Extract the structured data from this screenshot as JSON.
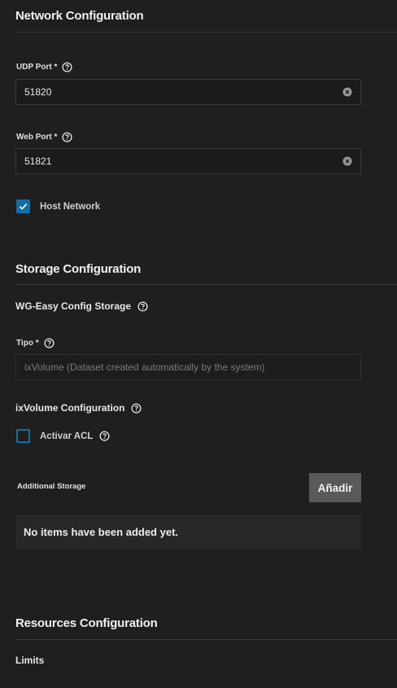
{
  "network": {
    "title": "Network Configuration",
    "udp_port": {
      "label": "UDP Port *",
      "value": "51820"
    },
    "web_port": {
      "label": "Web Port *",
      "value": "51821"
    },
    "host_network": {
      "label": "Host Network",
      "checked": true
    }
  },
  "storage": {
    "title": "Storage Configuration",
    "config_storage_label": "WG-Easy Config Storage",
    "tipo": {
      "label": "Tipo *",
      "value": "ixVolume (Dataset created automatically by the system)"
    },
    "ixvolume_label": "ixVolume Configuration",
    "acl": {
      "label": "Activar ACL",
      "checked": false
    },
    "additional_label": "Additional Storage",
    "add_button": "Añadir",
    "empty_message": "No items have been added yet."
  },
  "resources": {
    "title": "Resources Configuration",
    "limits_label": "Limits"
  },
  "colors": {
    "background": "#1f1f1f",
    "accent": "#0f6fa8",
    "button": "#595959"
  },
  "icons": [
    "help-icon",
    "clear-icon",
    "check-icon"
  ]
}
